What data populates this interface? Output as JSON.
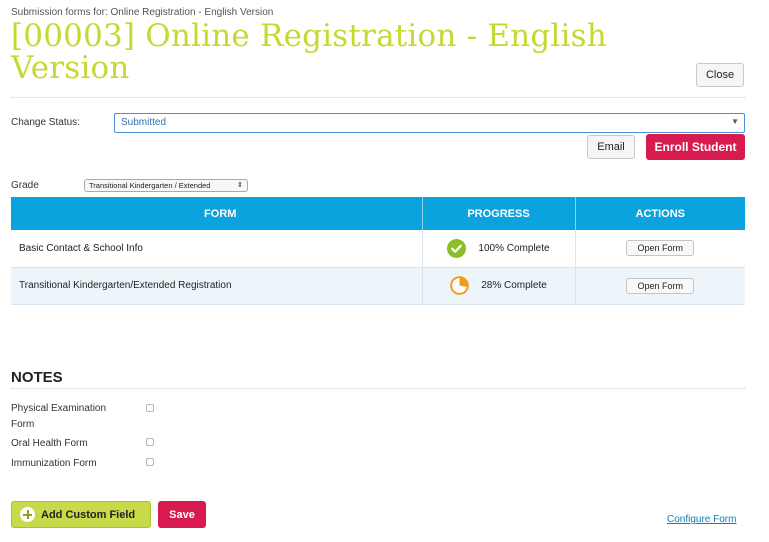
{
  "header": {
    "subtitle": "Submission forms for: Online Registration - English Version",
    "title": "[00003] Online Registration - English Version",
    "close_label": "Close"
  },
  "status": {
    "label": "Change Status:",
    "value": "Submitted"
  },
  "actions": {
    "email_label": "Email",
    "enroll_label": "Enroll Student"
  },
  "grade": {
    "label": "Grade",
    "value": "Transitional Kindergarten / Extended"
  },
  "forms_table": {
    "headers": [
      "FORM",
      "PROGRESS",
      "ACTIONS"
    ],
    "rows": [
      {
        "form": "Basic Contact & School Info",
        "progress_text": "100% Complete",
        "progress_value": 1.0,
        "progress_icon": "check-circle-icon",
        "action": "Open Form"
      },
      {
        "form": "Transitional Kindergarten/Extended Registration",
        "progress_text": "28% Complete",
        "progress_value": 0.28,
        "progress_icon": "pie-progress-icon",
        "action": "Open Form"
      }
    ]
  },
  "notes": {
    "heading": "NOTES",
    "items": [
      {
        "label": "Physical Examination Form",
        "checked": false
      },
      {
        "label": "Oral Health Form",
        "checked": false
      },
      {
        "label": "Immunization Form",
        "checked": false
      }
    ]
  },
  "footer": {
    "add_field_label": "Add Custom Field",
    "save_label": "Save",
    "configure_label": "Configure Form"
  },
  "colors": {
    "title": "#c5d930",
    "table_header": "#0aa3dd",
    "primary_button": "#d81b4f",
    "add_button": "#c8d94a",
    "complete": "#8cbf26",
    "partial": "#f39a1d"
  }
}
